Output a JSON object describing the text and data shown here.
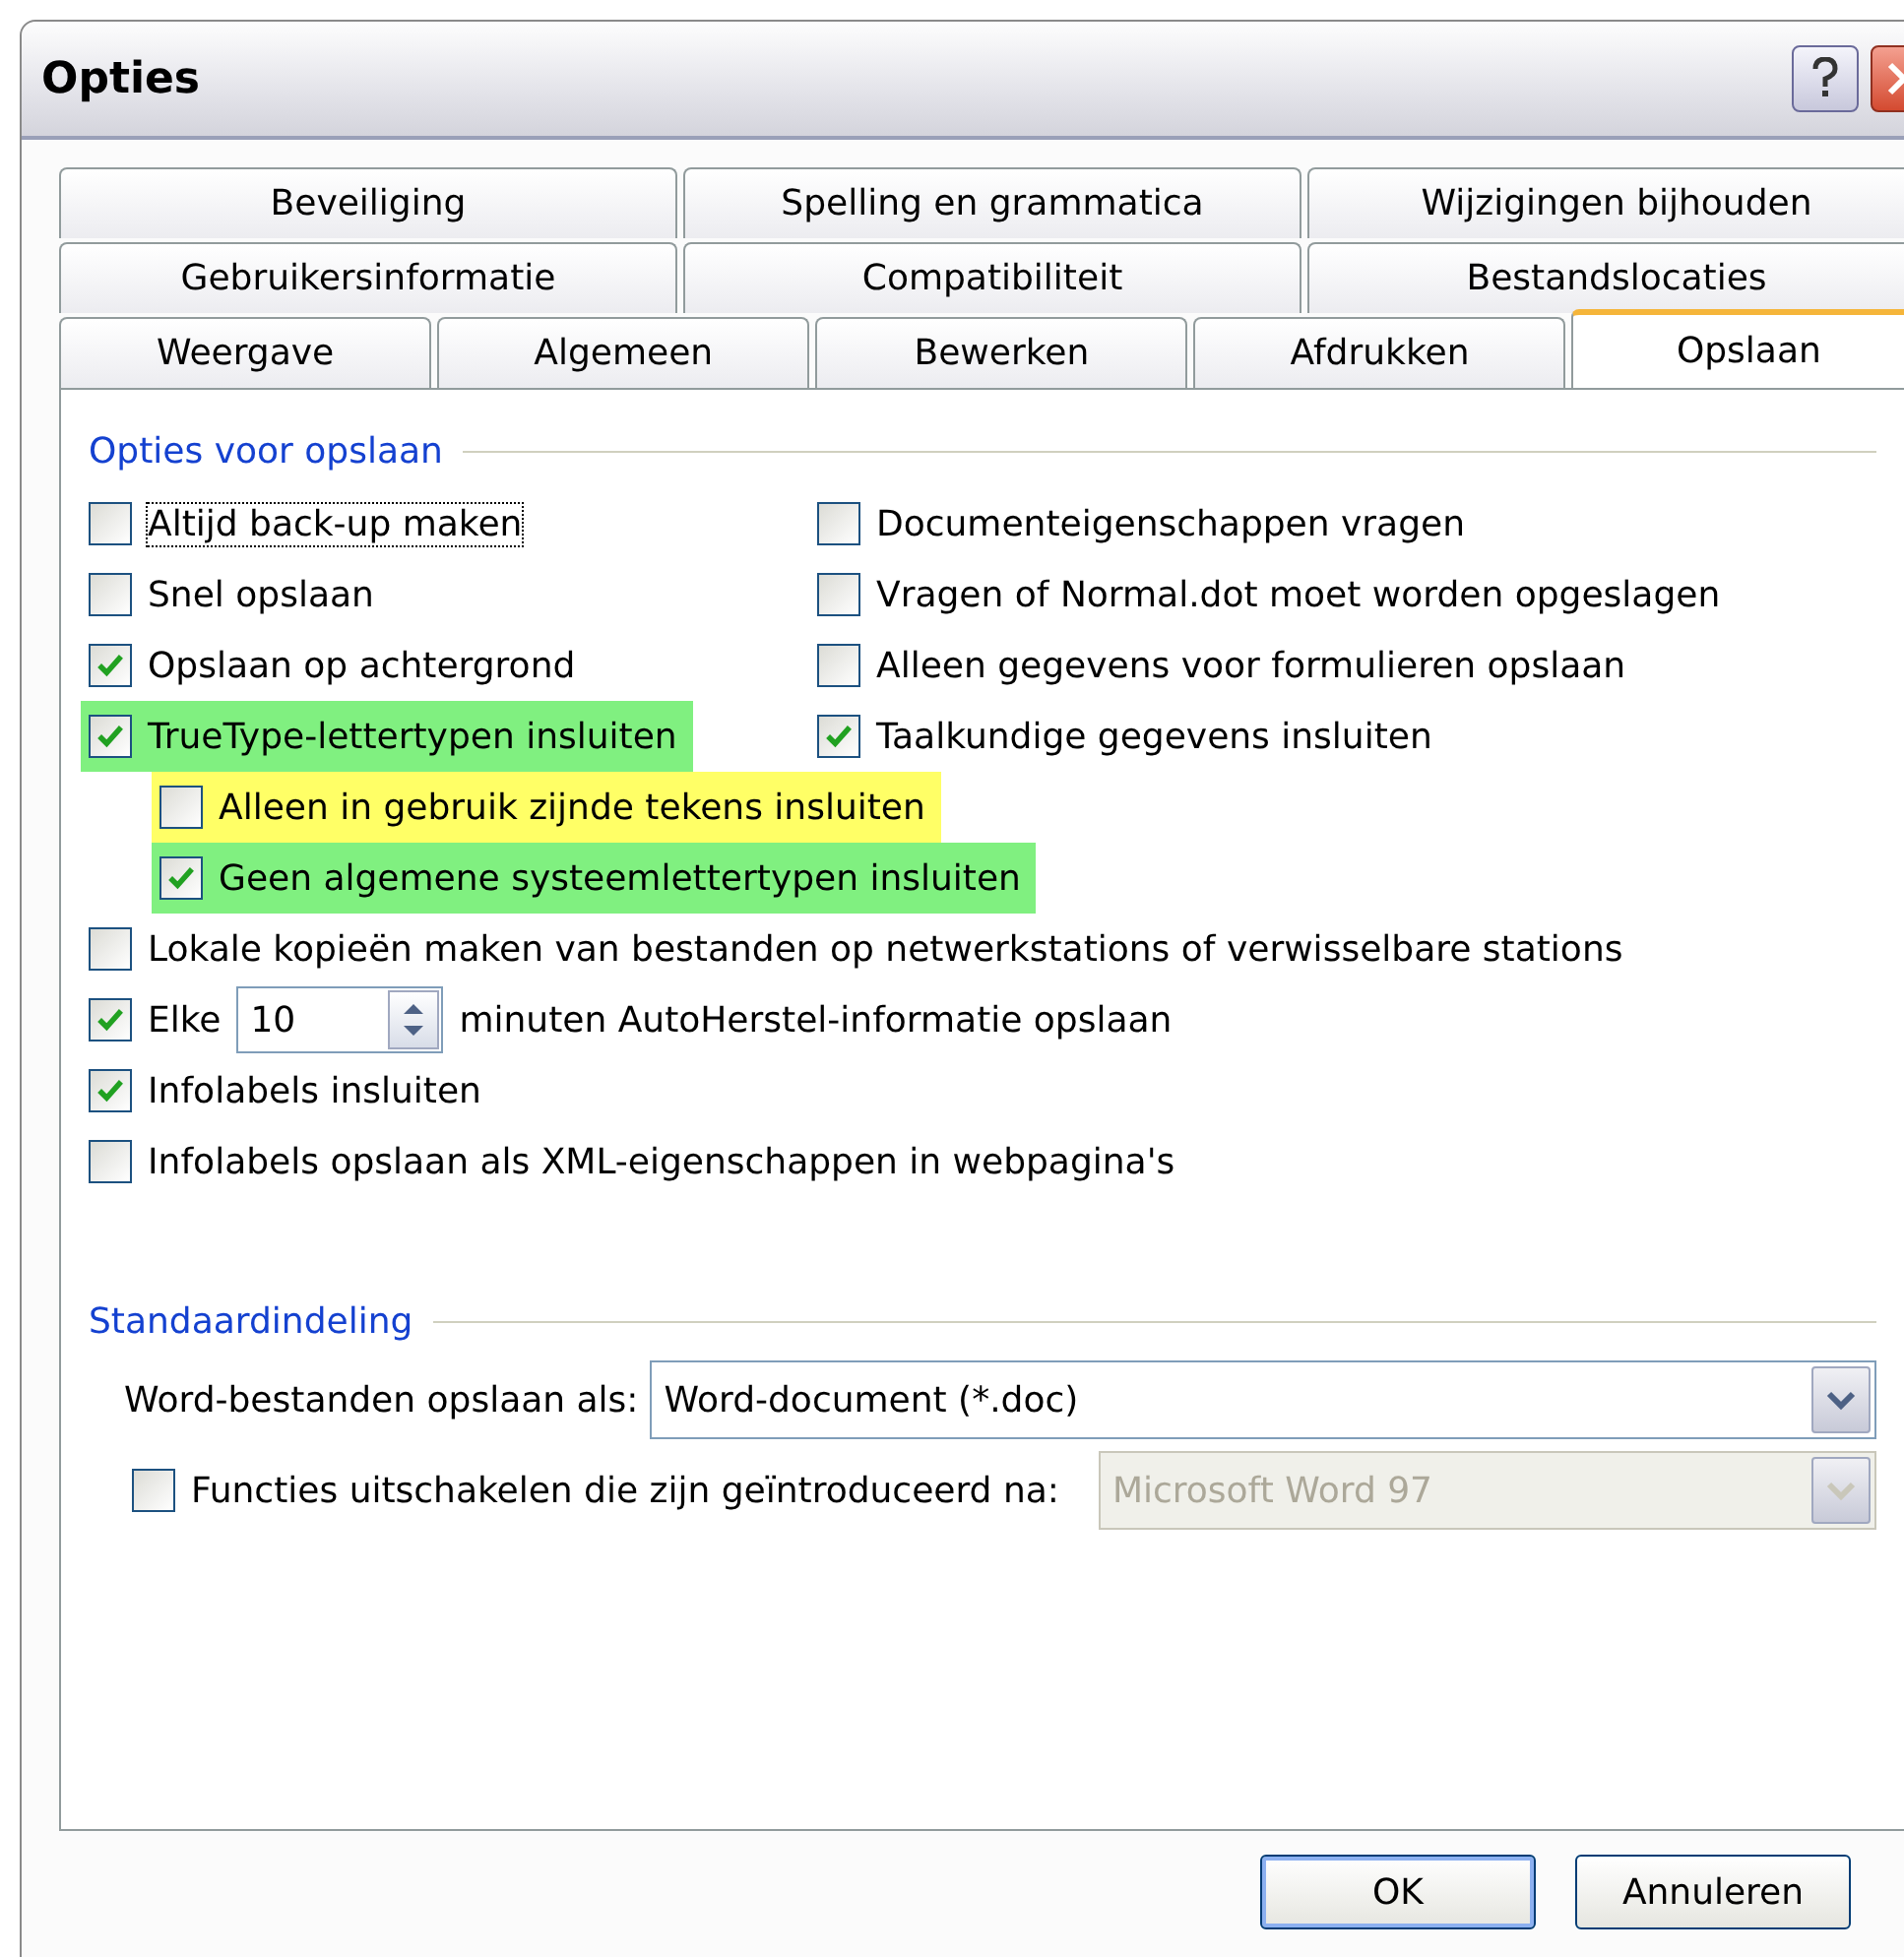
{
  "window": {
    "title": "Opties"
  },
  "tab_rows": [
    [
      {
        "label": "Beveiliging",
        "selected": false
      },
      {
        "label": "Spelling en grammatica",
        "selected": false
      },
      {
        "label": "Wijzigingen bijhouden",
        "selected": false
      }
    ],
    [
      {
        "label": "Gebruikersinformatie",
        "selected": false
      },
      {
        "label": "Compatibiliteit",
        "selected": false
      },
      {
        "label": "Bestandslocaties",
        "selected": false
      }
    ],
    [
      {
        "label": "Weergave",
        "selected": false
      },
      {
        "label": "Algemeen",
        "selected": false
      },
      {
        "label": "Bewerken",
        "selected": false
      },
      {
        "label": "Afdrukken",
        "selected": false
      },
      {
        "label": "Opslaan",
        "selected": true
      }
    ]
  ],
  "save_options": {
    "title": "Opties voor opslaan",
    "columns": [
      [
        {
          "label": "Altijd back-up maken",
          "checked": false,
          "focused": true
        },
        {
          "label": "Snel opslaan",
          "checked": false
        },
        {
          "label": "Opslaan op achtergrond",
          "checked": true
        },
        {
          "label": "TrueType-lettertypen insluiten",
          "checked": true,
          "color": "#80f080",
          "children": [
            {
              "label": "Alleen in gebruik zijnde tekens insluiten",
              "checked": false,
              "color": "#ffff66"
            },
            {
              "label": "Geen algemene systeemlettertypen insluiten",
              "checked": true,
              "color": "#80f080"
            }
          ]
        }
      ],
      [
        {
          "label": "Documenteigenschappen vragen",
          "checked": false
        },
        {
          "label": "Vragen of Normal.dot moet worden opgeslagen",
          "checked": false
        },
        {
          "label": "Alleen gegevens voor formulieren opslaan",
          "checked": false
        },
        {
          "label": "Taalkundige gegevens insluiten",
          "checked": true
        }
      ]
    ],
    "rows": [
      {
        "kind": "checkbox",
        "label": "Lokale kopieën maken van bestanden op netwerkstations of verwisselbare stations",
        "checked": false
      },
      {
        "kind": "interval",
        "label": "Elke",
        "checked": true,
        "value": "10",
        "suffix": "minuten AutoHerstel-informatie opslaan"
      },
      {
        "kind": "checkbox",
        "label": "Infolabels insluiten",
        "checked": true
      },
      {
        "kind": "checkbox",
        "label": "Infolabels opslaan als XML-eigenschappen in webpagina's",
        "checked": false
      }
    ]
  },
  "default_format": {
    "title": "Standaardindeling",
    "save_as": {
      "label": "Word-bestanden opslaan als:",
      "value": "Word-document (*.doc)",
      "disabled": false
    },
    "disable_features": {
      "label": "Functies uitschakelen die zijn geïntroduceerd na:",
      "checked": false,
      "value": "Microsoft Word 97",
      "disabled": true
    }
  },
  "buttons": [
    {
      "label": "OK",
      "default": true
    },
    {
      "label": "Annuleren",
      "default": false
    }
  ]
}
